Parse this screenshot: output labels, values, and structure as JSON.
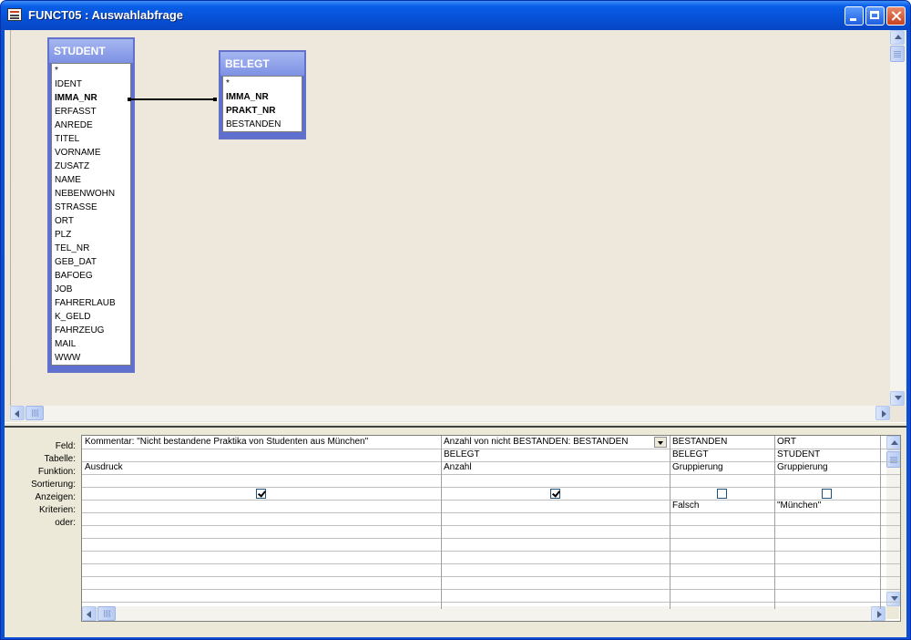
{
  "window": {
    "title": "FUNCT05 : Auswahlabfrage"
  },
  "tables": [
    {
      "name": "STUDENT",
      "fields": [
        {
          "label": "*",
          "key": false
        },
        {
          "label": "IDENT",
          "key": false
        },
        {
          "label": "IMMA_NR",
          "key": true
        },
        {
          "label": "ERFASST",
          "key": false
        },
        {
          "label": "ANREDE",
          "key": false
        },
        {
          "label": "TITEL",
          "key": false
        },
        {
          "label": "VORNAME",
          "key": false
        },
        {
          "label": "ZUSATZ",
          "key": false
        },
        {
          "label": "NAME",
          "key": false
        },
        {
          "label": "NEBENWOHN",
          "key": false
        },
        {
          "label": "STRASSE",
          "key": false
        },
        {
          "label": "ORT",
          "key": false
        },
        {
          "label": "PLZ",
          "key": false
        },
        {
          "label": "TEL_NR",
          "key": false
        },
        {
          "label": "GEB_DAT",
          "key": false
        },
        {
          "label": "BAFOEG",
          "key": false
        },
        {
          "label": "JOB",
          "key": false
        },
        {
          "label": "FAHRERLAUB",
          "key": false
        },
        {
          "label": "K_GELD",
          "key": false
        },
        {
          "label": "FAHRZEUG",
          "key": false
        },
        {
          "label": "MAIL",
          "key": false
        },
        {
          "label": "WWW",
          "key": false
        }
      ]
    },
    {
      "name": "BELEGT",
      "fields": [
        {
          "label": "*",
          "key": false
        },
        {
          "label": "IMMA_NR",
          "key": true
        },
        {
          "label": "PRAKT_NR",
          "key": true
        },
        {
          "label": "BESTANDEN",
          "key": false
        }
      ]
    }
  ],
  "grid": {
    "row_labels": [
      "Feld:",
      "Tabelle:",
      "Funktion:",
      "Sortierung:",
      "Anzeigen:",
      "Kriterien:",
      "oder:"
    ],
    "columns": [
      {
        "feld": "Kommentar: \"Nicht bestandene Praktika von Studenten aus München\"",
        "tabelle": "",
        "funktion": "Ausdruck",
        "sortierung": "",
        "anzeigen": true,
        "kriterien": "",
        "oder": ""
      },
      {
        "feld": "Anzahl von nicht BESTANDEN: BESTANDEN",
        "tabelle": "BELEGT",
        "funktion": "Anzahl",
        "sortierung": "",
        "anzeigen": true,
        "kriterien": "",
        "oder": ""
      },
      {
        "feld": "BESTANDEN",
        "tabelle": "BELEGT",
        "funktion": "Gruppierung",
        "sortierung": "",
        "anzeigen": false,
        "kriterien": "Falsch",
        "oder": ""
      },
      {
        "feld": "ORT",
        "tabelle": "STUDENT",
        "funktion": "Gruppierung",
        "sortierung": "",
        "anzeigen": false,
        "kriterien": "\"München\"",
        "oder": ""
      }
    ]
  },
  "icons": {
    "window_icon": "query-window-icon",
    "minimize": "minimize-icon",
    "maximize": "maximize-icon",
    "close": "close-icon"
  },
  "colors": {
    "titlebar": "#0a5ee8",
    "field_list_header": "#7d91e4",
    "workspace": "#ece9d8"
  }
}
